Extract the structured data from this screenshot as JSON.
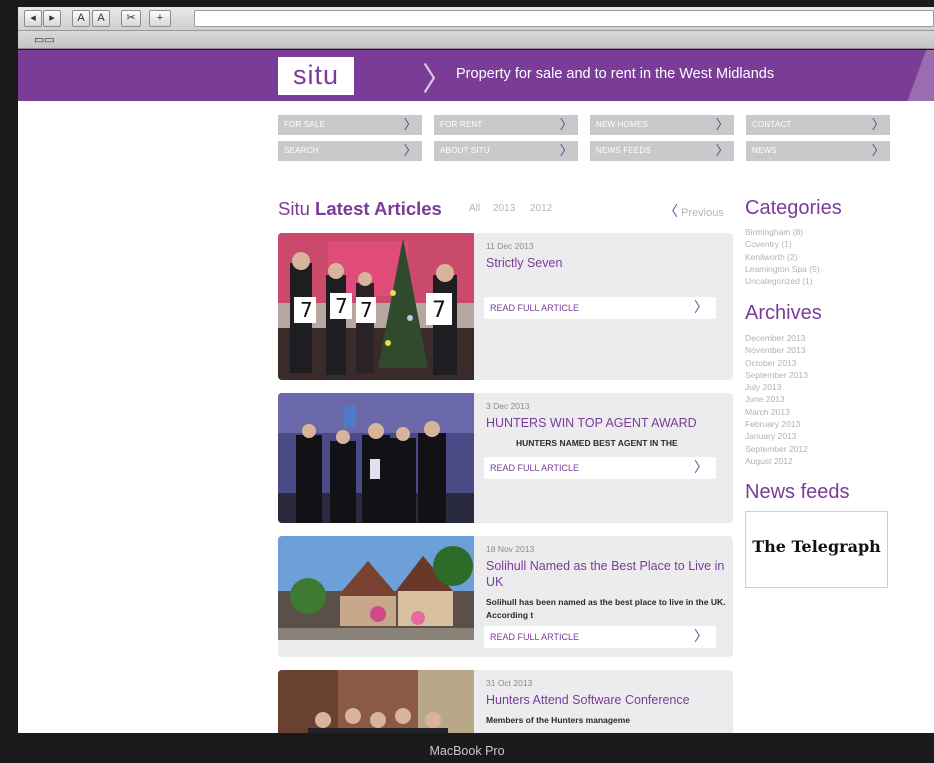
{
  "browser": {
    "buttons": [
      "◂",
      "▸",
      "A",
      "A",
      "✂",
      "+"
    ],
    "bookmarks_icon": "book-icon"
  },
  "header": {
    "logo": "situ",
    "tagline": "Property for sale and to rent in the West Midlands"
  },
  "nav": [
    {
      "label": "FOR SALE"
    },
    {
      "label": "FOR RENT"
    },
    {
      "label": "NEW HOMES"
    },
    {
      "label": "CONTACT"
    },
    {
      "label": "SEARCH"
    },
    {
      "label": "ABOUT SITU"
    },
    {
      "label": "NEWS FEEDS"
    },
    {
      "label": "NEWS"
    }
  ],
  "articles_section": {
    "title_prefix": "Situ",
    "title_bold": "Latest Articles",
    "filters": [
      "All",
      "2013",
      "2012"
    ],
    "previous_label": "Previous"
  },
  "articles": [
    {
      "date": "11 Dec 2013",
      "title": "Strictly Seven",
      "excerpt": "",
      "read_label": "READ FULL ARTICLE"
    },
    {
      "date": "3 Dec 2013",
      "title": "HUNTERS WIN TOP AGENT AWARD",
      "excerpt": "HUNTERS NAMED BEST AGENT IN THE",
      "read_label": "READ FULL ARTICLE"
    },
    {
      "date": "18 Nov 2013",
      "title": "Solihull Named as the Best Place to Live in UK",
      "excerpt": "Solihull has been named as the best place to live in the UK. According t",
      "read_label": "READ FULL ARTICLE"
    },
    {
      "date": "31 Oct 2013",
      "title": "Hunters Attend Software Conference",
      "excerpt": "Members of the Hunters manageme",
      "read_label": ""
    }
  ],
  "sidebar": {
    "categories_title": "Categories",
    "categories": [
      "Birmingham (8)",
      "Coventry (1)",
      "Kenilworth (2)",
      "Leamington Spa (5)",
      "Uncategorized (1)"
    ],
    "archives_title": "Archives",
    "archives": [
      "December 2013",
      "November 2013",
      "October 2013",
      "September 2013",
      "July 2013",
      "June 2013",
      "March 2013",
      "February 2013",
      "January 2013",
      "September 2012",
      "August 2012"
    ],
    "news_feeds_title": "News feeds",
    "news_feed_logo": "The Telegraph"
  },
  "device_label": "MacBook Pro",
  "colors": {
    "brand_purple": "#7a3c97",
    "nav_grey": "#c9c9cb",
    "card_bg": "#ececee"
  }
}
